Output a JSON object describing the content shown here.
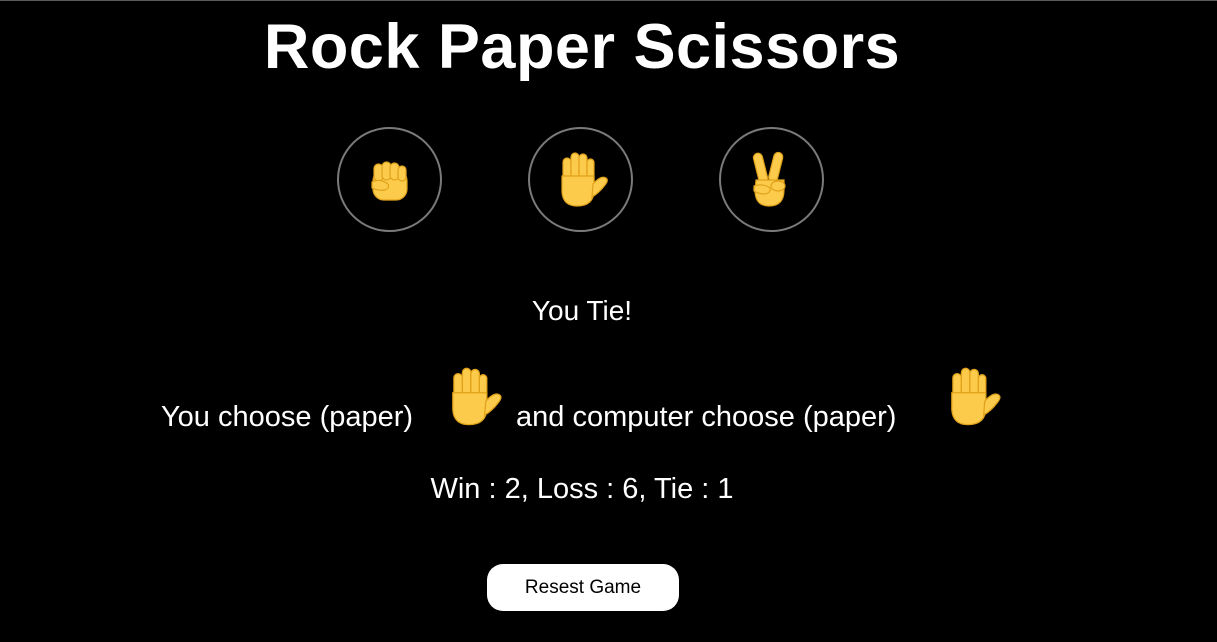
{
  "game": {
    "title": "Rock Paper Scissors",
    "choices": [
      {
        "id": "rock",
        "icon": "raised-fist-icon"
      },
      {
        "id": "paper",
        "icon": "raised-hand-icon"
      },
      {
        "id": "scissors",
        "icon": "victory-hand-icon"
      }
    ]
  },
  "result": {
    "message": "You Tie!",
    "player_text": "You choose (paper)",
    "player_icon": "raised-hand-icon",
    "computer_text": "and computer choose (paper)",
    "computer_icon": "raised-hand-icon"
  },
  "score": {
    "text": "Win : 2, Loss : 6, Tie : 1"
  },
  "controls": {
    "reset_label": "Resest Game"
  },
  "colors": {
    "background": "#000000",
    "text": "#ffffff",
    "circle_border": "#7a7a7a",
    "emoji_skin": "#FDCB4C",
    "emoji_outline": "#E0A21A"
  }
}
